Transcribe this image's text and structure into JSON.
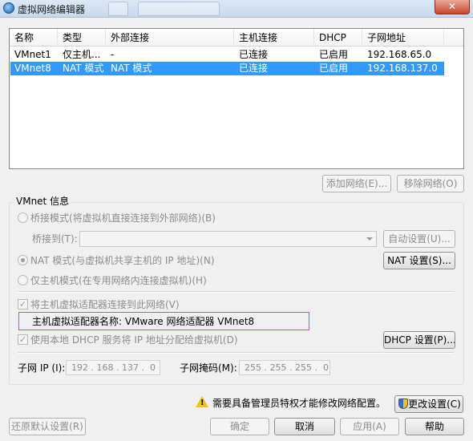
{
  "window": {
    "title": "虚拟网络编辑器",
    "close_label": "✕"
  },
  "list": {
    "columns": [
      "名称",
      "类型",
      "外部连接",
      "主机连接",
      "DHCP",
      "子网地址"
    ],
    "rows": [
      {
        "name": "VMnet1",
        "type": "仅主机...",
        "external": "-",
        "host": "已连接",
        "dhcp": "已启用",
        "subnet": "192.168.65.0",
        "selected": false
      },
      {
        "name": "VMnet8",
        "type": "NAT 模式",
        "external": "NAT 模式",
        "host": "已连接",
        "dhcp": "已启用",
        "subnet": "192.168.137.0",
        "selected": true
      }
    ]
  },
  "list_buttons": {
    "add": "添加网络(E)...",
    "remove": "移除网络(O)"
  },
  "vmnet_info": {
    "group_label": "VMnet 信息",
    "bridge_mode": "桥接模式(将虚拟机直接连接到外部网络)(B)",
    "bridge_to_label": "桥接到(T):",
    "bridge_to_value": "",
    "auto_setting": "自动设置(U)...",
    "nat_mode": "NAT 模式(与虚拟机共享主机的 IP 地址)(N)",
    "nat_settings": "NAT 设置(S)...",
    "host_only_mode": "仅主机模式(在专用网络内连接虚拟机)(H)",
    "connect_adapter": "将主机虚拟适配器连接到此网络(V)",
    "adapter_name": "主机虚拟适配器名称: VMware 网络适配器 VMnet8",
    "use_dhcp": "使用本地 DHCP 服务将 IP 地址分配给虚拟机(D)",
    "dhcp_settings": "DHCP 设置(P)...",
    "subnet_ip_label": "子网 IP (I):",
    "subnet_ip": "192 . 168 . 137 .  0",
    "subnet_mask_label": "子网掩码(M):",
    "subnet_mask": "255 . 255 . 255 .  0"
  },
  "footer": {
    "admin_warning": "需要具备管理员特权才能修改网络配置。",
    "change_settings": "更改设置(C)",
    "restore_defaults": "还原默认设置(R)",
    "ok": "确定",
    "cancel": "取消",
    "apply": "应用(A)",
    "help": "帮助"
  }
}
